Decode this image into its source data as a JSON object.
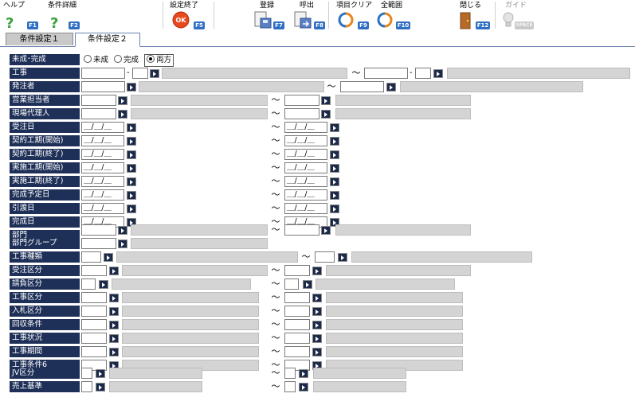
{
  "toolbar": {
    "help": {
      "label": "ヘルプ",
      "key": "F1"
    },
    "detail": {
      "label": "条件詳細",
      "key": "F2"
    },
    "settings_done": {
      "label": "設定終了",
      "key": "F5",
      "icon_text": "OK"
    },
    "register": {
      "label": "登録",
      "key": "F7"
    },
    "recall": {
      "label": "呼出",
      "key": "F8"
    },
    "clear_item": {
      "label": "項目クリア",
      "key": "F9"
    },
    "select_all": {
      "label": "全範囲",
      "key": "F10"
    },
    "close": {
      "label": "閉じる",
      "key": "F12"
    },
    "guide": {
      "label": "ガイド",
      "key": "SPACE"
    }
  },
  "tabs": [
    {
      "label": "条件設定１"
    },
    {
      "label": "条件設定２"
    }
  ],
  "form": {
    "status": {
      "label": "未成･完成",
      "options": [
        "未成",
        "完成",
        "両方"
      ],
      "selected": "両方"
    },
    "construction": {
      "label": "工事",
      "from_value": "",
      "to_value": ""
    },
    "orderer": {
      "label": "発注者"
    },
    "sales_rep": {
      "label": "営業担当者"
    },
    "site_agent": {
      "label": "現場代理人"
    },
    "date_fields": [
      {
        "label": "受注日",
        "value": "＿/＿/＿"
      },
      {
        "label": "契約工期(開始)",
        "value": "＿/＿/＿"
      },
      {
        "label": "契約工期(終了)",
        "value": "＿/＿/＿"
      },
      {
        "label": "実施工期(開始)",
        "value": "＿/＿/＿"
      },
      {
        "label": "実施工期(終了)",
        "value": "＿/＿/＿"
      },
      {
        "label": "完成予定日",
        "value": "＿/＿/＿"
      },
      {
        "label": "引渡日",
        "value": "＿/＿/＿"
      },
      {
        "label": "完成日",
        "value": "＿/＿/＿"
      }
    ],
    "department": {
      "label": "部門"
    },
    "department_group": {
      "label": "部門グループ"
    },
    "work_type": {
      "label": "工事種類"
    },
    "order_class": {
      "label": "受注区分"
    },
    "contract_class": {
      "label": "請負区分"
    },
    "range_fields": [
      {
        "label": "工事区分"
      },
      {
        "label": "入札区分"
      },
      {
        "label": "回収条件"
      },
      {
        "label": "工事状況"
      },
      {
        "label": "工事期間"
      },
      {
        "label": "工事条件6"
      }
    ],
    "jv_class": {
      "label": "JV区分"
    },
    "sales_basis": {
      "label": "売上基準"
    },
    "tilde": "～",
    "dash": "-"
  }
}
